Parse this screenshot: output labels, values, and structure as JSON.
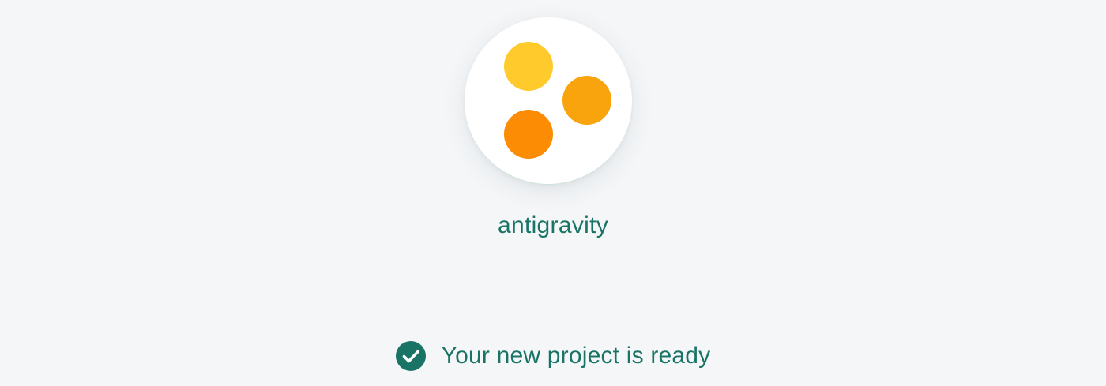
{
  "project": {
    "name": "antigravity",
    "logo": {
      "icon": "three-dots-logo-icon",
      "colors": {
        "yellow": "#ffca2b",
        "amber": "#f9a40c",
        "orange": "#fb8c04"
      }
    }
  },
  "status": {
    "icon": "check-circle-icon",
    "text": "Your new project is ready",
    "color": "#1a7466"
  },
  "theme": {
    "background": "#f4f6f8",
    "accent": "#1a7466"
  }
}
